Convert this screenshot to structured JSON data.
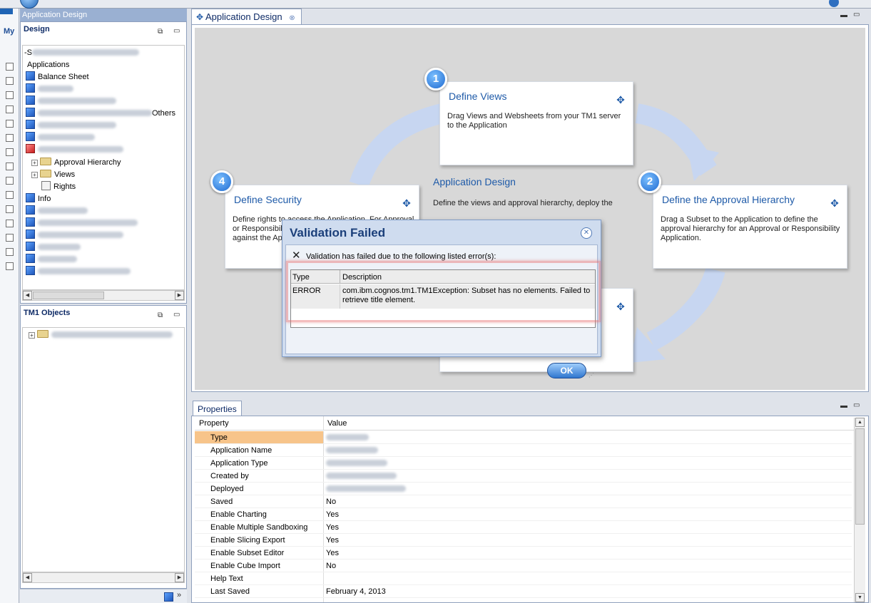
{
  "left_strip": {
    "label": "My"
  },
  "design_panel": {
    "window_title": "Application Design",
    "title": "Design",
    "tree": {
      "root_prefix": "-S",
      "applications_label": "Applications",
      "balance_sheet": "Balance Sheet",
      "others_suffix": "Others",
      "approval_hierarchy": "Approval Hierarchy",
      "views": "Views",
      "rights": "Rights",
      "info": "Info"
    }
  },
  "tm1_objects_panel": {
    "title": "TM1 Objects"
  },
  "editor": {
    "tab_label": "Application Design",
    "center_title": "Application Design",
    "center_desc": "Define the views and approval hierarchy, deploy the",
    "cards": [
      {
        "number": "1",
        "title": "Define Views",
        "desc": "Drag Views and Websheets from your TM1 server to the Application"
      },
      {
        "number": "2",
        "title": "Define the Approval Hierarchy",
        "desc": "Drag a Subset to the Application to define the approval hierarchy for an Approval or Responsibility Application."
      },
      {
        "number": "4",
        "title": "Define Security",
        "desc_line1": "Define rights to access the Application. For Approval",
        "desc_line2": "or Responsibili",
        "desc_line3": "against the Ap"
      }
    ]
  },
  "dialog": {
    "title": "Validation Failed",
    "message": "Validation has failed due to the following listed error(s):",
    "columns": [
      "Type",
      "Description"
    ],
    "rows": [
      {
        "type": "ERROR",
        "description": "com.ibm.cognos.tm1.TM1Exception: Subset has no elements. Failed to retrieve title element."
      }
    ],
    "ok_label": "OK"
  },
  "properties": {
    "tab_label": "Properties",
    "columns": [
      "Property",
      "Value"
    ],
    "rows": [
      {
        "name": "Type",
        "value": ""
      },
      {
        "name": "Application Name",
        "value": ""
      },
      {
        "name": "Application Type",
        "value": ""
      },
      {
        "name": "Created by",
        "value": ""
      },
      {
        "name": "Deployed",
        "value": ""
      },
      {
        "name": "Saved",
        "value": "No"
      },
      {
        "name": "Enable Charting",
        "value": "Yes"
      },
      {
        "name": "Enable Multiple Sandboxing",
        "value": "Yes"
      },
      {
        "name": "Enable Slicing Export",
        "value": "Yes"
      },
      {
        "name": "Enable Subset Editor",
        "value": "Yes"
      },
      {
        "name": "Enable Cube Import",
        "value": "No"
      },
      {
        "name": "Help Text",
        "value": ""
      },
      {
        "name": "Last Saved",
        "value": "February 4, 2013"
      }
    ]
  },
  "colors": {
    "selected_row": "#f7c48a",
    "title_blue": "#0d2a66",
    "accent": "#1e5aa8"
  }
}
